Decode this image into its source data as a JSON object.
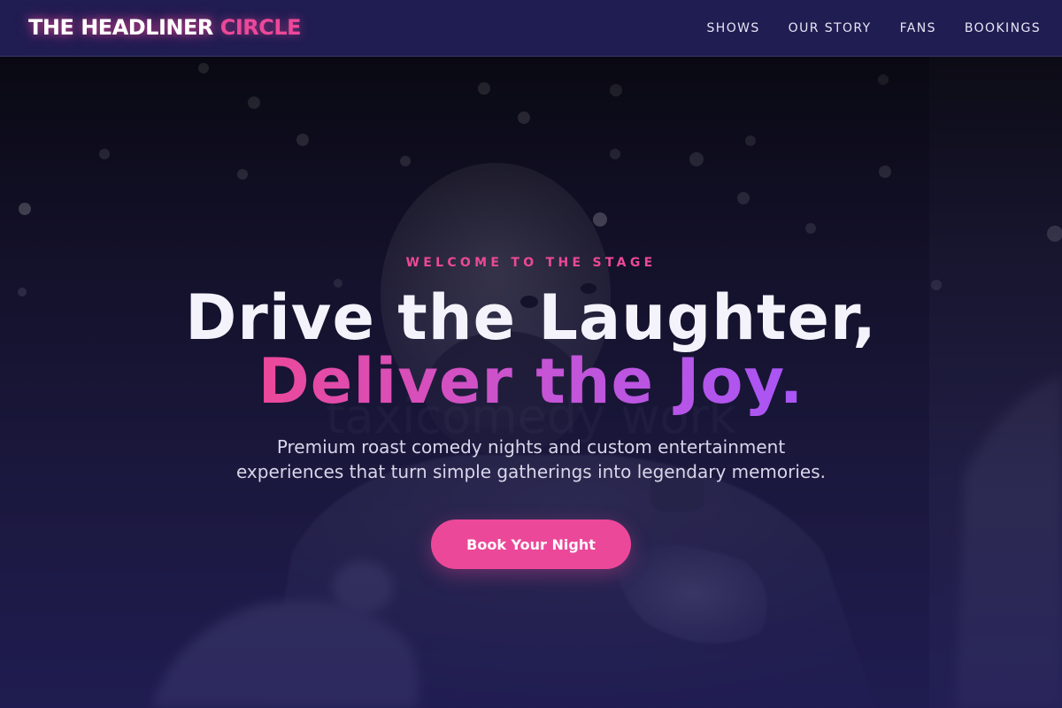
{
  "brand": {
    "name_main": "THE HEADLINER",
    "name_accent": "CIRCLE"
  },
  "nav": {
    "items": [
      {
        "label": "SHOWS"
      },
      {
        "label": "OUR STORY"
      },
      {
        "label": "FANS"
      },
      {
        "label": "BOOKINGS"
      }
    ]
  },
  "hero": {
    "eyebrow": "WELCOME TO THE STAGE",
    "headline_line1": "Drive the Laughter,",
    "headline_line2": "Deliver the Joy.",
    "subtitle_line1": "Premium roast comedy nights and custom entertainment",
    "subtitle_line2": "experiences that turn simple gatherings into legendary memories.",
    "cta_label": "Book Your Night",
    "background_image": "comedian-on-stage-with-microphone",
    "watermark_text": "taxicomedy work"
  },
  "colors": {
    "accent_pink": "#ec4899",
    "accent_purple": "#a855f7",
    "header_bg": "#201d52",
    "hero_bottom": "#1c1a45"
  }
}
